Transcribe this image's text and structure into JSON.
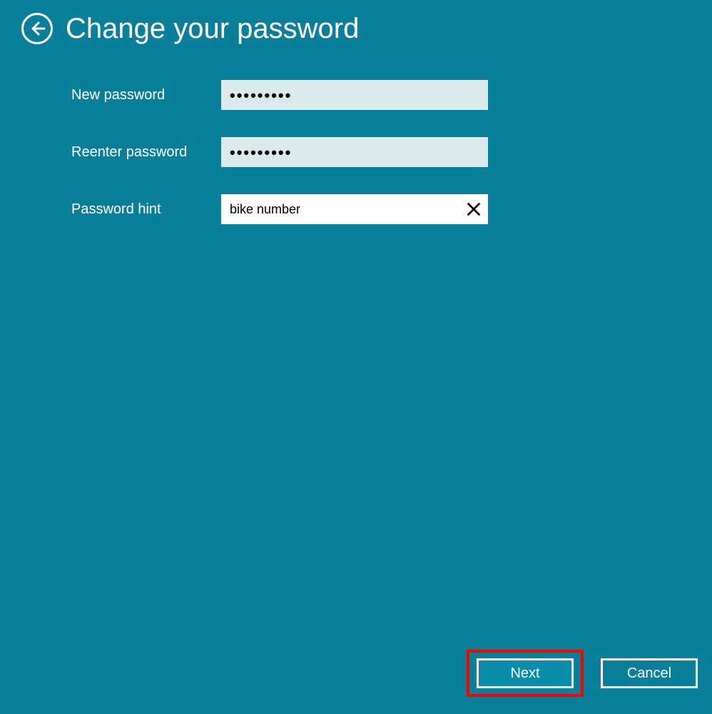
{
  "header": {
    "title": "Change your password"
  },
  "form": {
    "new_password": {
      "label": "New password",
      "value": "•••••••••"
    },
    "reenter_password": {
      "label": "Reenter password",
      "value": "•••••••••"
    },
    "password_hint": {
      "label": "Password hint",
      "value": "bike number"
    }
  },
  "footer": {
    "next_label": "Next",
    "cancel_label": "Cancel"
  },
  "colors": {
    "background": "#0a7f9a",
    "highlight": "#ff0000",
    "input_filled": "#d9e9ec"
  }
}
